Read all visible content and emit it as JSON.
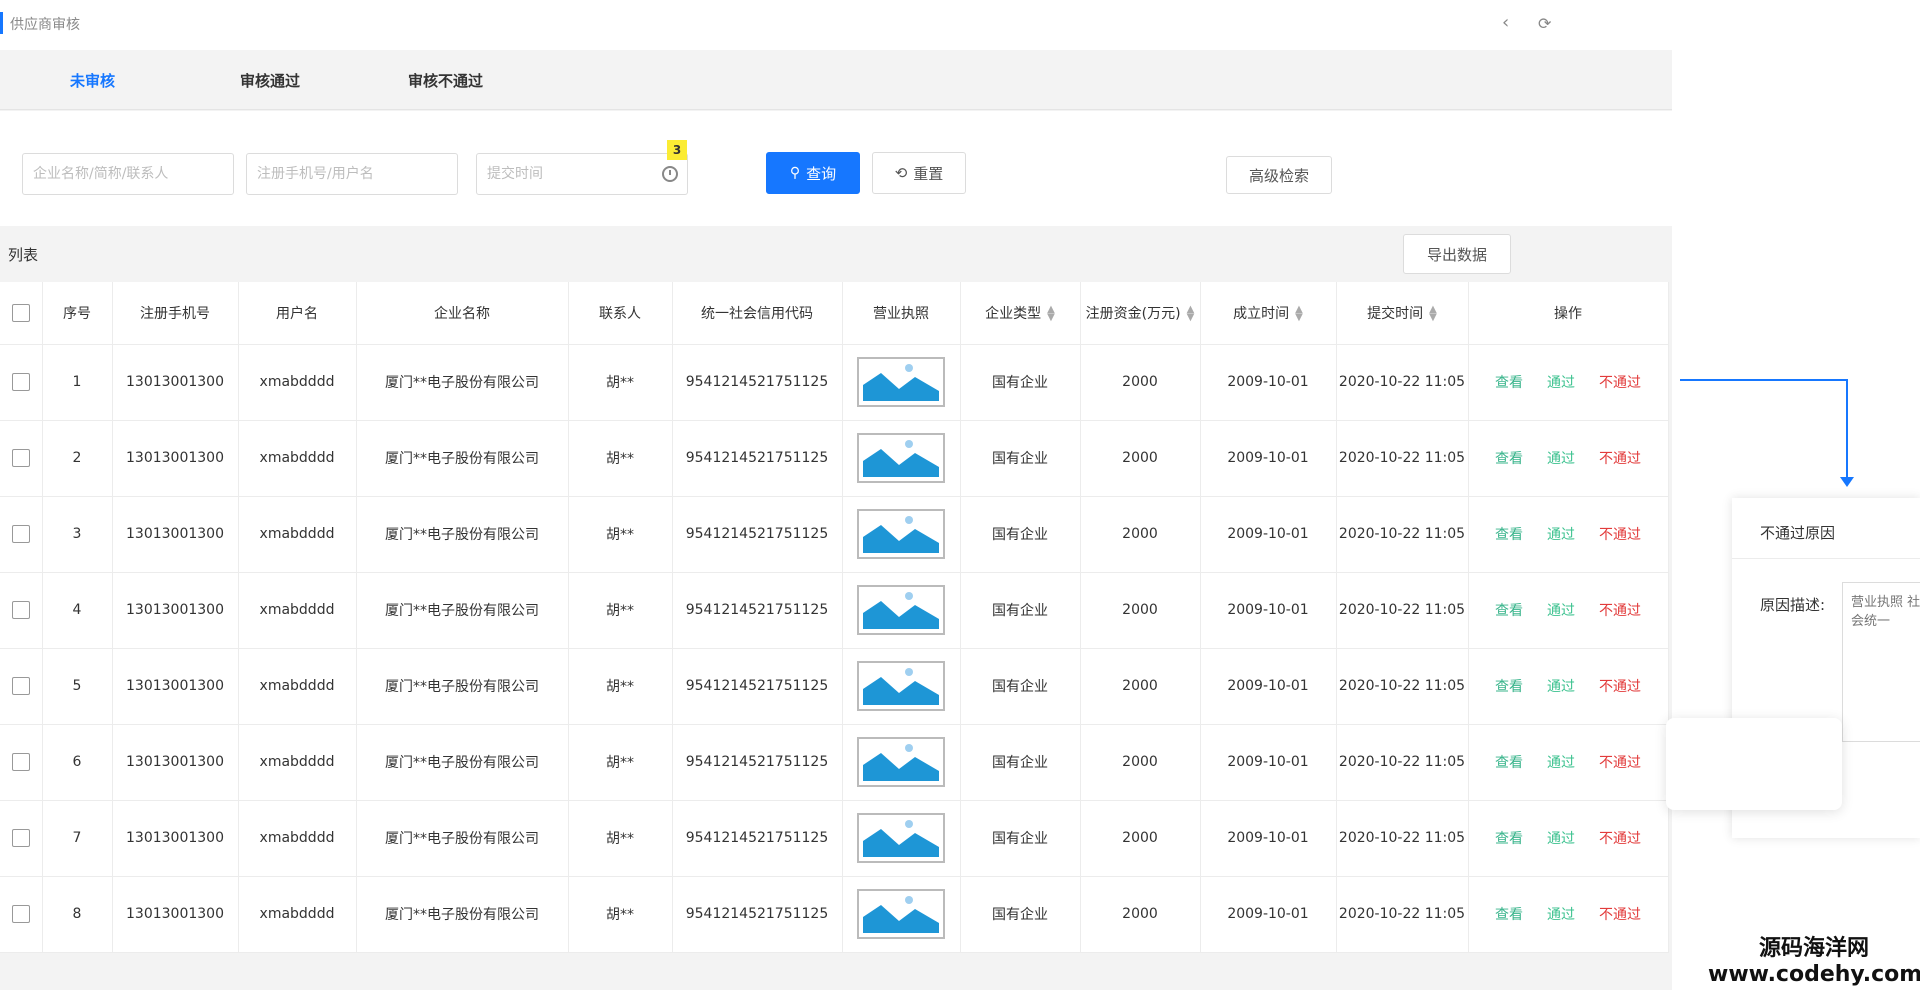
{
  "header": {
    "title": "供应商审核",
    "back_icon": "chevron-left-icon",
    "refresh_icon": "refresh-icon"
  },
  "tabs": [
    {
      "label": "未审核",
      "active": true
    },
    {
      "label": "审核通过",
      "active": false
    },
    {
      "label": "审核不通过",
      "active": false
    }
  ],
  "search": {
    "company_placeholder": "企业名称/简称/联系人",
    "phone_placeholder": "注册手机号/用户名",
    "time_placeholder": "提交时间",
    "time_badge": "3",
    "query_label": "查询",
    "reset_label": "重置",
    "advanced_label": "高级检索"
  },
  "list": {
    "label": "列表",
    "export_label": "导出数据"
  },
  "table": {
    "columns": [
      "序号",
      "注册手机号",
      "用户名",
      "企业名称",
      "联系人",
      "统一社会信用代码",
      "营业执照",
      "企业类型",
      "注册资金(万元)",
      "成立时间",
      "提交时间",
      "操作"
    ],
    "rows": [
      {
        "index": "1",
        "phone": "13013001300",
        "username": "xmabdddd",
        "company": "厦门**电子股份有限公司",
        "contact": "胡**",
        "credit_code": "9541214521751125",
        "type": "国有企业",
        "capital": "2000",
        "founded": "2009-10-01",
        "submitted": "2020-10-22 11:05"
      },
      {
        "index": "2",
        "phone": "13013001300",
        "username": "xmabdddd",
        "company": "厦门**电子股份有限公司",
        "contact": "胡**",
        "credit_code": "9541214521751125",
        "type": "国有企业",
        "capital": "2000",
        "founded": "2009-10-01",
        "submitted": "2020-10-22 11:05"
      },
      {
        "index": "3",
        "phone": "13013001300",
        "username": "xmabdddd",
        "company": "厦门**电子股份有限公司",
        "contact": "胡**",
        "credit_code": "9541214521751125",
        "type": "国有企业",
        "capital": "2000",
        "founded": "2009-10-01",
        "submitted": "2020-10-22 11:05"
      },
      {
        "index": "4",
        "phone": "13013001300",
        "username": "xmabdddd",
        "company": "厦门**电子股份有限公司",
        "contact": "胡**",
        "credit_code": "9541214521751125",
        "type": "国有企业",
        "capital": "2000",
        "founded": "2009-10-01",
        "submitted": "2020-10-22 11:05"
      },
      {
        "index": "5",
        "phone": "13013001300",
        "username": "xmabdddd",
        "company": "厦门**电子股份有限公司",
        "contact": "胡**",
        "credit_code": "9541214521751125",
        "type": "国有企业",
        "capital": "2000",
        "founded": "2009-10-01",
        "submitted": "2020-10-22 11:05"
      },
      {
        "index": "6",
        "phone": "13013001300",
        "username": "xmabdddd",
        "company": "厦门**电子股份有限公司",
        "contact": "胡**",
        "credit_code": "9541214521751125",
        "type": "国有企业",
        "capital": "2000",
        "founded": "2009-10-01",
        "submitted": "2020-10-22 11:05"
      },
      {
        "index": "7",
        "phone": "13013001300",
        "username": "xmabdddd",
        "company": "厦门**电子股份有限公司",
        "contact": "胡**",
        "credit_code": "9541214521751125",
        "type": "国有企业",
        "capital": "2000",
        "founded": "2009-10-01",
        "submitted": "2020-10-22 11:05"
      },
      {
        "index": "8",
        "phone": "13013001300",
        "username": "xmabdddd",
        "company": "厦门**电子股份有限公司",
        "contact": "胡**",
        "credit_code": "9541214521751125",
        "type": "国有企业",
        "capital": "2000",
        "founded": "2009-10-01",
        "submitted": "2020-10-22 11:05"
      }
    ],
    "actions": {
      "view": "查看",
      "pass": "通过",
      "reject": "不通过"
    }
  },
  "reject_panel": {
    "title": "不通过原因",
    "reason_label": "原因描述:",
    "reason_placeholder": "营业执照 社会统一"
  },
  "watermark": {
    "line1": "源码海洋网",
    "line2": "www.codehy.com"
  },
  "colors": {
    "accent": "#1677ff",
    "view": "#38b48b",
    "pass": "#3cc28f",
    "reject": "#e23b3b",
    "badge": "#fbec34"
  }
}
